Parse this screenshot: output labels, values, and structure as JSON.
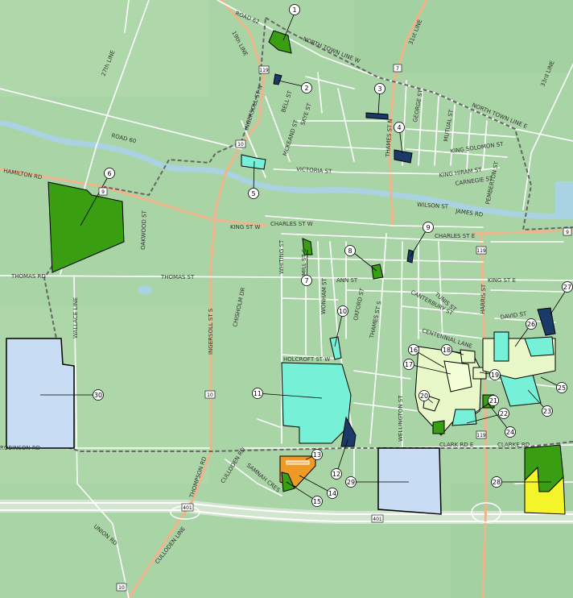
{
  "map": {
    "colors": {
      "background": "#a9d4a6",
      "road": "#ffffff",
      "highway": "#f0b48c",
      "water": "#a9d3e3",
      "boundary": "#666666",
      "green_parcel": "#3a9e12",
      "dark_blue_parcel": "#1a3a6a",
      "aqua_parcel": "#76f0d6",
      "light_blue_parcel": "#c8dcf4",
      "orange_parcel": "#f09a26",
      "yellow_parcel": "#f4f42a",
      "pale_green_parcel": "#e8f8c8"
    },
    "road_labels": {
      "road62": "ROAD 62",
      "line19": "19th LINE",
      "north_town_line_w": "NORTH TOWN LINE W",
      "north_town_line_e": "NORTH TOWN LINE E",
      "line31": "31st LINE",
      "line27": "27th LINE",
      "line33": "33rd LINE",
      "road60": "ROAD 60",
      "hamilton_rd": "HAMILTON RD",
      "ingersoll_st_n": "INGERSOLL ST N",
      "bell_st": "BELL ST",
      "skye_st": "SKYE ST",
      "mckeand_st": "MCKEAND ST",
      "victoria_st": "VICTORIA ST",
      "george_st": "GEORGE ST",
      "thames_st_n": "THAMES ST N",
      "mutual_st": "MUTUAL ST",
      "king_solomon_st": "KING SOLOMON ST",
      "king_hiram_st": "KING HIRAM ST",
      "carnegie_st": "CARNEGIE ST",
      "pemberton_st": "PEMBERTON ST",
      "wilson_st": "WILSON ST",
      "james_rd": "JAMES RD",
      "king_st_w": "KING ST W",
      "charles_st_w": "CHARLES ST W",
      "charles_st_e": "CHARLES ST E",
      "oakwood_st": "OAKWOOD ST",
      "thomas_rd": "THOMAS RD",
      "thomas_st": "THOMAS ST",
      "whiting_st": "WHITING ST",
      "mill_st_s": "MILL ST S",
      "wonham_st": "WONHAM ST",
      "ann_st": "ANN ST",
      "oxford_st": "OXFORD ST",
      "thames_st_s": "THAMES ST S",
      "king_st_e": "KING ST E",
      "tunis_st": "TUNIS ST",
      "canterbury_st": "CANTERBURY ST",
      "harris_st": "HARRIS ST",
      "david_st": "DAVID ST",
      "centennial_lane": "CENTENNIAL LANE",
      "wallace_line": "WALLACE LINE",
      "chisholm_dr": "CHISHOLM DR",
      "ingersoll_st_s": "INGERSOLL ST S",
      "holcroft_st_w": "HOLCROFT ST W",
      "wellington_st": "WELLINGTON ST",
      "clark_rd_e": "CLARK RD E",
      "clarke_rd": "CLARKE RD",
      "robinson_rd": "ROBINSON RD",
      "thompson_rd": "THOMPSON RD",
      "culloden_rd": "CULLODEN RD",
      "samnah_cres": "SAMNAH CRES",
      "culloden_line": "CULLODEN LINE",
      "union_rd": "UNION RD"
    },
    "route_shields": [
      "119",
      "7",
      "10",
      "9",
      "119",
      "9",
      "119",
      "10",
      "401",
      "401",
      "10"
    ],
    "parcel_labels": [
      "1",
      "2",
      "3",
      "4",
      "5",
      "6",
      "7",
      "8",
      "9",
      "10",
      "11",
      "12",
      "13",
      "14",
      "15",
      "16",
      "17",
      "18",
      "19",
      "20",
      "21",
      "22",
      "23",
      "24",
      "25",
      "26",
      "27",
      "28",
      "29",
      "30"
    ]
  }
}
